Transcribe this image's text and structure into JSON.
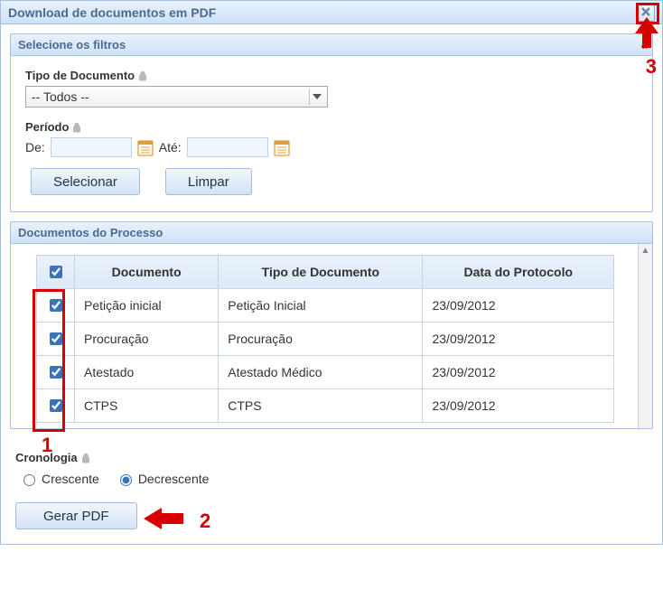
{
  "window": {
    "title": "Download de documentos em PDF"
  },
  "filters": {
    "section_title": "Selecione os filtros",
    "collapse_glyph": "«",
    "type_label": "Tipo de Documento",
    "dropdown_selected": "-- Todos --",
    "period_label": "Período",
    "de_label": "De:",
    "ate_label": "Até:",
    "select_button": "Selecionar",
    "clear_button": "Limpar"
  },
  "documents": {
    "section_title": "Documentos do Processo",
    "columns": {
      "doc": "Documento",
      "type": "Tipo de Documento",
      "date": "Data do Protocolo"
    },
    "rows": [
      {
        "doc": "Petição inicial",
        "type": "Petição Inicial",
        "date": "23/09/2012"
      },
      {
        "doc": "Procuração",
        "type": "Procuração",
        "date": "23/09/2012"
      },
      {
        "doc": "Atestado",
        "type": "Atestado Médico",
        "date": "23/09/2012"
      },
      {
        "doc": "CTPS",
        "type": "CTPS",
        "date": "23/09/2012"
      }
    ]
  },
  "cronologia": {
    "label": "Cronologia",
    "asc_label": "Crescente",
    "desc_label": "Decrescente"
  },
  "generate_button": "Gerar PDF",
  "annotations": {
    "n1": "1",
    "n2": "2",
    "n3": "3"
  }
}
